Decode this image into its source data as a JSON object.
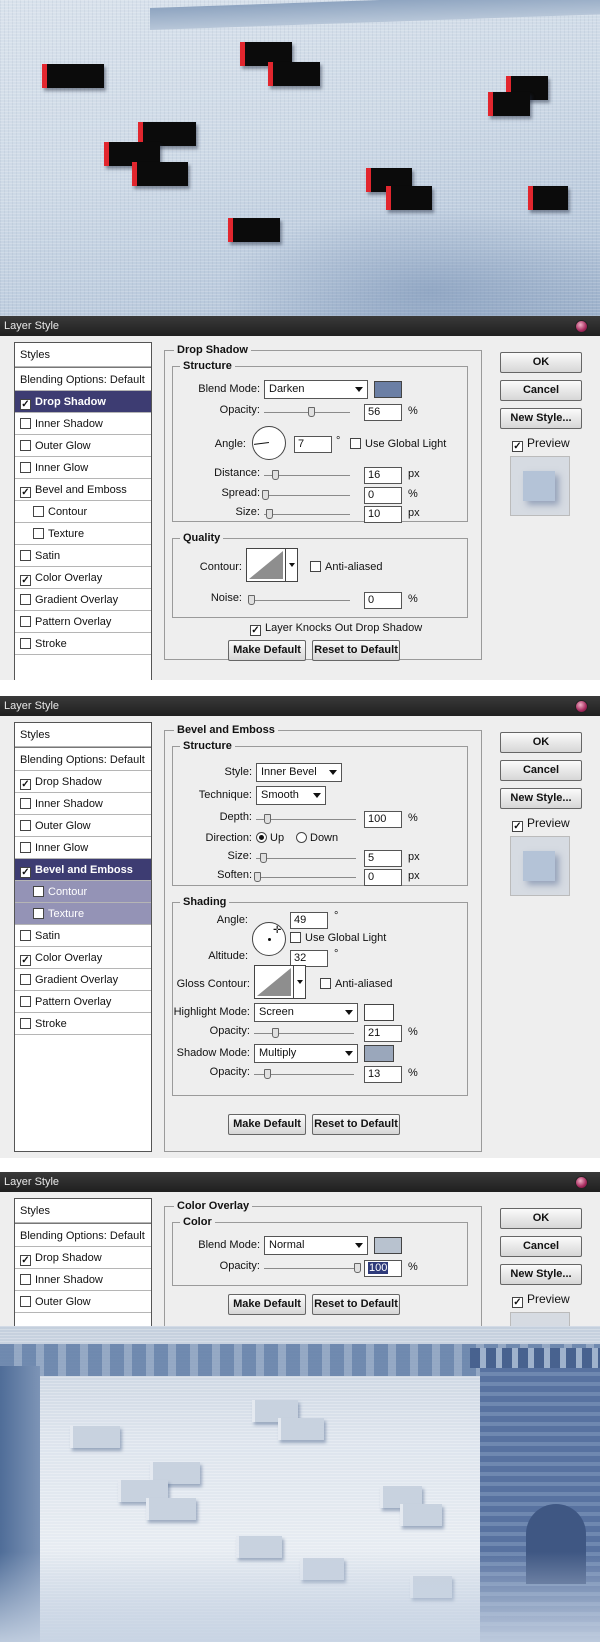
{
  "dialogs": {
    "dialog1": {
      "title": "Layer Style",
      "sidebar": [
        {
          "label": "Styles",
          "kind": "header"
        },
        {
          "label": "Blending Options: Default",
          "kind": "opts"
        },
        {
          "label": "Drop Shadow",
          "checked": true,
          "selected": true
        },
        {
          "label": "Inner Shadow",
          "checked": false
        },
        {
          "label": "Outer Glow",
          "checked": false
        },
        {
          "label": "Inner Glow",
          "checked": false
        },
        {
          "label": "Bevel and Emboss",
          "checked": true
        },
        {
          "label": "Contour",
          "checked": false,
          "indent": true
        },
        {
          "label": "Texture",
          "checked": false,
          "indent": true
        },
        {
          "label": "Satin",
          "checked": false
        },
        {
          "label": "Color Overlay",
          "checked": true
        },
        {
          "label": "Gradient Overlay",
          "checked": false
        },
        {
          "label": "Pattern Overlay",
          "checked": false
        },
        {
          "label": "Stroke",
          "checked": false
        }
      ],
      "panel_title": "Drop Shadow",
      "structure_title": "Structure",
      "blend_mode_label": "Blend Mode:",
      "blend_mode": "Darken",
      "blend_color": "#6b7fa5",
      "opacity_label": "Opacity:",
      "opacity": "56",
      "opacity_value": 56,
      "angle_label": "Angle:",
      "angle": "7",
      "angle_deg": 7,
      "degree": "°",
      "use_global_light": "Use Global Light",
      "distance_label": "Distance:",
      "distance": "16",
      "spread_label": "Spread:",
      "spread": "0",
      "size_label": "Size:",
      "size": "10",
      "quality_title": "Quality",
      "contour_label": "Contour:",
      "anti_aliased": "Anti-aliased",
      "noise_label": "Noise:",
      "noise": "0",
      "knockout": "Layer Knocks Out Drop Shadow",
      "unit_pct": "%",
      "unit_px": "px",
      "make_default": "Make Default",
      "reset_default": "Reset to Default",
      "ok": "OK",
      "cancel": "Cancel",
      "new_style": "New Style...",
      "preview": "Preview"
    },
    "dialog2": {
      "title": "Layer Style",
      "sidebar": [
        {
          "label": "Styles",
          "kind": "header"
        },
        {
          "label": "Blending Options: Default",
          "kind": "opts"
        },
        {
          "label": "Drop Shadow",
          "checked": true
        },
        {
          "label": "Inner Shadow",
          "checked": false
        },
        {
          "label": "Outer Glow",
          "checked": false
        },
        {
          "label": "Inner Glow",
          "checked": false
        },
        {
          "label": "Bevel and Emboss",
          "checked": true,
          "selected": true
        },
        {
          "label": "Contour",
          "checked": false,
          "indent": true,
          "subselected": true
        },
        {
          "label": "Texture",
          "checked": false,
          "indent": true,
          "subselected": true
        },
        {
          "label": "Satin",
          "checked": false
        },
        {
          "label": "Color Overlay",
          "checked": true
        },
        {
          "label": "Gradient Overlay",
          "checked": false
        },
        {
          "label": "Pattern Overlay",
          "checked": false
        },
        {
          "label": "Stroke",
          "checked": false
        }
      ],
      "panel_title": "Bevel and Emboss",
      "structure_title": "Structure",
      "style_label": "Style:",
      "style": "Inner Bevel",
      "technique_label": "Technique:",
      "technique": "Smooth",
      "depth_label": "Depth:",
      "depth": "100",
      "direction_label": "Direction:",
      "up": "Up",
      "down": "Down",
      "size_label": "Size:",
      "size": "5",
      "soften_label": "Soften:",
      "soften": "0",
      "shading_title": "Shading",
      "angle_label": "Angle:",
      "angle": "49",
      "altitude_label": "Altitude:",
      "altitude": "32",
      "degree": "°",
      "use_global_light": "Use Global Light",
      "gloss_label": "Gloss Contour:",
      "anti_aliased": "Anti-aliased",
      "highlight_label": "Highlight Mode:",
      "highlight_mode": "Screen",
      "highlight_color": "#ffffff",
      "opacity_label": "Opacity:",
      "highlight_opacity": "21",
      "shadow_label": "Shadow Mode:",
      "shadow_mode": "Multiply",
      "shadow_color": "#9aa7bb",
      "shadow_opacity": "13",
      "unit_pct": "%",
      "unit_px": "px",
      "make_default": "Make Default",
      "reset_default": "Reset to Default",
      "ok": "OK",
      "cancel": "Cancel",
      "new_style": "New Style...",
      "preview": "Preview"
    },
    "dialog3": {
      "title": "Layer Style",
      "sidebar": [
        {
          "label": "Styles",
          "kind": "header"
        },
        {
          "label": "Blending Options: Default",
          "kind": "opts"
        },
        {
          "label": "Drop Shadow",
          "checked": true
        },
        {
          "label": "Inner Shadow",
          "checked": false
        },
        {
          "label": "Outer Glow",
          "checked": false
        }
      ],
      "panel_title": "Color Overlay",
      "color_title": "Color",
      "blend_mode_label": "Blend Mode:",
      "blend_mode": "Normal",
      "overlay_color": "#b8c2cf",
      "opacity_label": "Opacity:",
      "opacity": "100",
      "unit_pct": "%",
      "make_default": "Make Default",
      "reset_default": "Reset to Default",
      "ok": "OK",
      "cancel": "Cancel",
      "new_style": "New Style...",
      "preview": "Preview"
    }
  }
}
